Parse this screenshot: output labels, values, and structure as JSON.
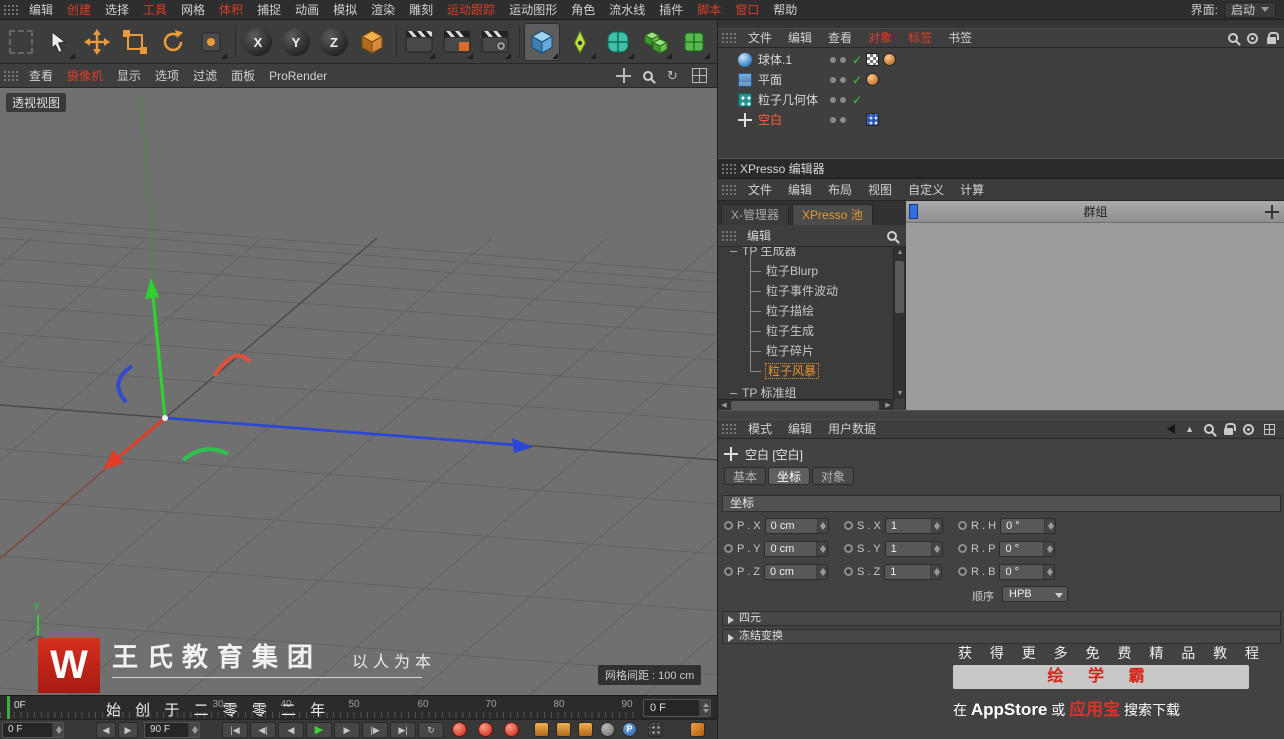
{
  "colors": {
    "menu_highlight": "#d8402a",
    "selected_object": "#ff6038",
    "tab_active_orange": "#e89a30",
    "axis_x": "#e03c28",
    "axis_y": "#2fd22f",
    "axis_z": "#2b46d8"
  },
  "icons": {
    "check": "✓",
    "loop": "↻",
    "play": "▶",
    "prev_frame": "◀",
    "next_frame": "▶",
    "goto_start": "|◀",
    "goto_end": "▶|",
    "prev_key": "◀|",
    "next_key": "|▶",
    "up_arrow": "▲",
    "scroll_up": "▲",
    "scroll_down": "▼",
    "scroll_left": "◀",
    "scroll_right": "▶",
    "pla_letter": "P"
  },
  "menubar": {
    "items": [
      {
        "label": "编辑"
      },
      {
        "label": "创建"
      },
      {
        "label": "选择"
      },
      {
        "label": "工具"
      },
      {
        "label": "网格"
      },
      {
        "label": "体积"
      },
      {
        "label": "捕捉"
      },
      {
        "label": "动画"
      },
      {
        "label": "模拟"
      },
      {
        "label": "渲染"
      },
      {
        "label": "雕刻"
      },
      {
        "label": "运动跟踪"
      },
      {
        "label": "运动图形"
      },
      {
        "label": "角色"
      },
      {
        "label": "流水线"
      },
      {
        "label": "插件"
      },
      {
        "label": "脚本"
      },
      {
        "label": "窗口"
      },
      {
        "label": "帮助"
      }
    ],
    "interface_label": "界面:",
    "interface_value": "启动"
  },
  "toolbar": {
    "x": "X",
    "y": "Y",
    "z": "Z"
  },
  "vpmenu": {
    "items": [
      {
        "label": "查看"
      },
      {
        "label": "摄像机"
      },
      {
        "label": "显示"
      },
      {
        "label": "选项"
      },
      {
        "label": "过滤"
      },
      {
        "label": "面板"
      },
      {
        "label": "ProRender"
      }
    ]
  },
  "viewport": {
    "view_label": "透视视图",
    "grid_spacing": "网格间距 : 100 cm",
    "axis_y_label": "Y"
  },
  "watermark": {
    "logo_letter": "W",
    "brand": "王氏教育集团",
    "slogan": "以人为本",
    "founded": "始 创 于 二 零 零 二 年"
  },
  "ruler": {
    "playhead": "0F",
    "ticks": [
      "30",
      "40",
      "50",
      "60",
      "70",
      "80",
      "90"
    ],
    "frame_field": "0 F"
  },
  "transport": {
    "current": "0 F",
    "end": "90 F"
  },
  "om": {
    "menu": [
      "文件",
      "编辑",
      "查看",
      "对象",
      "标签",
      "书签"
    ],
    "objects": [
      {
        "name": "球体.1"
      },
      {
        "name": "平面"
      },
      {
        "name": "粒子几何体"
      },
      {
        "name": "空白"
      }
    ]
  },
  "xp": {
    "title": "XPresso 编辑器",
    "menu": [
      "文件",
      "编辑",
      "布局",
      "视图",
      "自定义",
      "计算"
    ],
    "tabs": [
      {
        "label": "X-管理器"
      },
      {
        "label": "XPresso 池"
      }
    ],
    "pool_menu_label": "编辑",
    "tree": [
      {
        "label": "TP 生成器"
      },
      {
        "label": "粒子Blurp"
      },
      {
        "label": "粒子事件波动"
      },
      {
        "label": "粒子描绘"
      },
      {
        "label": "粒子生成"
      },
      {
        "label": "粒子碎片"
      },
      {
        "label": "粒子风暴"
      },
      {
        "label": "TP 标准组"
      }
    ],
    "canvas_header": "群组"
  },
  "am": {
    "menu": [
      "模式",
      "编辑",
      "用户数据"
    ],
    "object_title": "空白 [空白]",
    "tabs": [
      "基本",
      "坐标",
      "对象"
    ],
    "section": "坐标",
    "fields": {
      "px": {
        "label": "P . X",
        "value": "0 cm"
      },
      "py": {
        "label": "P . Y",
        "value": "0 cm"
      },
      "pz": {
        "label": "P . Z",
        "value": "0 cm"
      },
      "sx": {
        "label": "S . X",
        "value": "1"
      },
      "sy": {
        "label": "S . Y",
        "value": "1"
      },
      "sz": {
        "label": "S . Z",
        "value": "1"
      },
      "rh": {
        "label": "R . H",
        "value": "0 °"
      },
      "rp": {
        "label": "R . P",
        "value": "0 °"
      },
      "rb": {
        "label": "R . B",
        "value": "0 °"
      }
    },
    "order_label": "顺序",
    "order_value": "HPB",
    "quaternion": "四元",
    "freeze": "冻结变换"
  },
  "ad": {
    "line1": "获 得 更 多 免 费 精 品 教 程",
    "banner": "绘 学 霸",
    "l2a": "在 ",
    "l2b": "AppStore",
    "l2c": " 或 ",
    "l2d": "应用宝",
    "l2e": " 搜索下载"
  }
}
